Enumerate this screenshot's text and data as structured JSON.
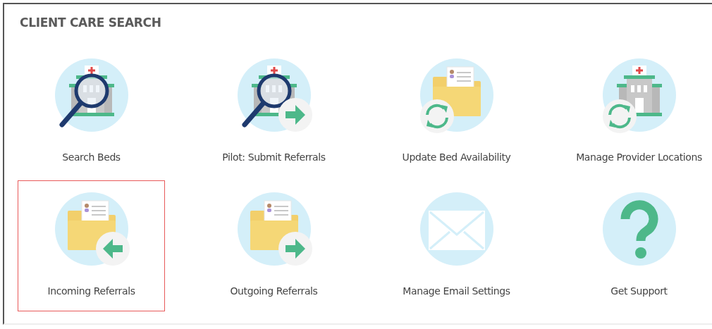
{
  "panel": {
    "title": "CLIENT CARE SEARCH"
  },
  "tiles": [
    {
      "label": "Search Beds",
      "kind": "hospital-search",
      "selected": false
    },
    {
      "label": "Pilot: Submit Referrals",
      "kind": "hospital-search-send",
      "selected": false
    },
    {
      "label": "Update Bed Availability",
      "kind": "folder-sync",
      "selected": false
    },
    {
      "label": "Manage Provider Locations",
      "kind": "hospital-sync",
      "selected": false
    },
    {
      "label": "Incoming Referrals",
      "kind": "folder-in",
      "selected": true
    },
    {
      "label": "Outgoing Referrals",
      "kind": "folder-out",
      "selected": false
    },
    {
      "label": "Manage Email Settings",
      "kind": "envelope",
      "selected": false
    },
    {
      "label": "Get Support",
      "kind": "question",
      "selected": false
    }
  ]
}
